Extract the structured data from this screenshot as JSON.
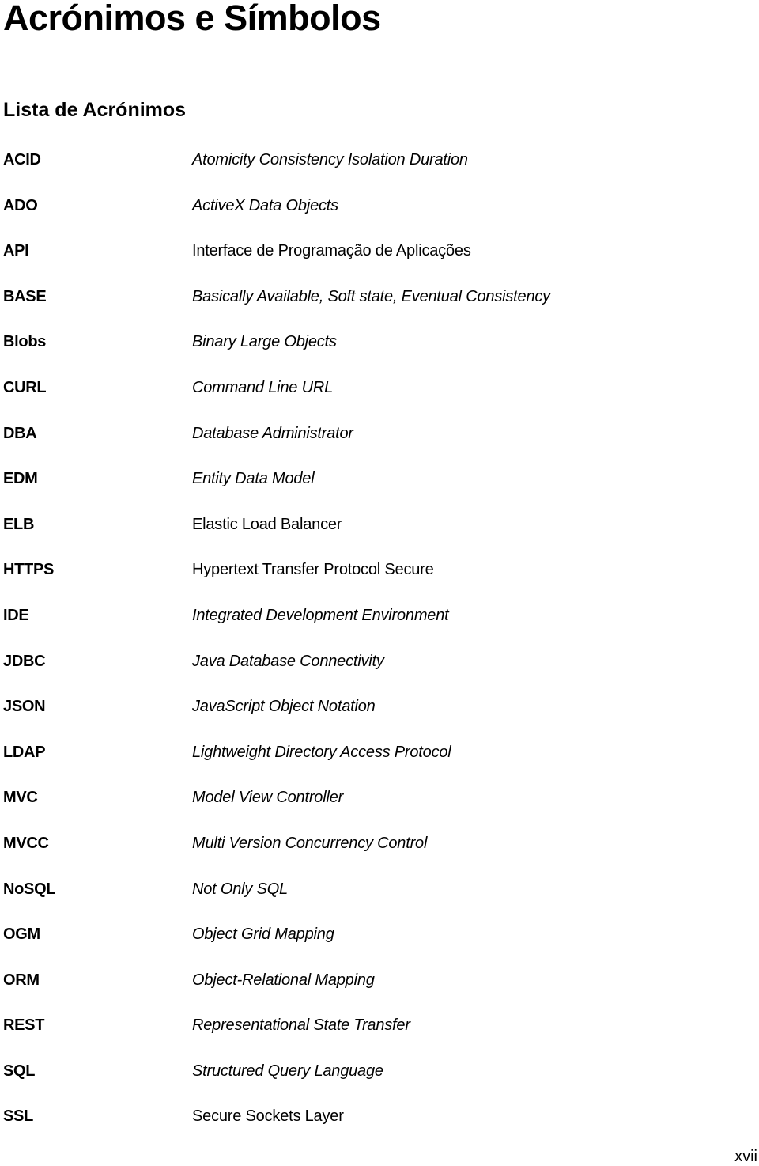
{
  "document": {
    "title": "Acrónimos e Símbolos",
    "section_title": "Lista de Acrónimos",
    "page_number": "xvii"
  },
  "acronyms": [
    {
      "term": "ACID",
      "definition": "Atomicity Consistency Isolation Duration",
      "italic": true
    },
    {
      "term": "ADO",
      "definition": "ActiveX Data Objects",
      "italic": true
    },
    {
      "term": "API",
      "definition": "Interface de Programação de Aplicações",
      "italic": false
    },
    {
      "term": "BASE",
      "definition": "Basically Available, Soft state, Eventual Consistency",
      "italic": true
    },
    {
      "term": "Blobs",
      "definition": "Binary Large Objects",
      "italic": true
    },
    {
      "term": "CURL",
      "definition": "Command Line URL",
      "italic": true
    },
    {
      "term": "DBA",
      "definition": "Database Administrator",
      "italic": true
    },
    {
      "term": "EDM",
      "definition": "Entity Data Model",
      "italic": true
    },
    {
      "term": "ELB",
      "definition": "Elastic Load Balancer",
      "italic": false
    },
    {
      "term": "HTTPS",
      "definition": "Hypertext Transfer Protocol Secure",
      "italic": false
    },
    {
      "term": "IDE",
      "definition": "Integrated Development Environment",
      "italic": true
    },
    {
      "term": "JDBC",
      "definition": "Java Database Connectivity",
      "italic": true
    },
    {
      "term": "JSON",
      "definition": "JavaScript Object Notation",
      "italic": true
    },
    {
      "term": "LDAP",
      "definition": "Lightweight Directory Access Protocol",
      "italic": true
    },
    {
      "term": "MVC",
      "definition": "Model View Controller",
      "italic": true
    },
    {
      "term": "MVCC",
      "definition": "Multi Version Concurrency Control",
      "italic": true
    },
    {
      "term": "NoSQL",
      "definition": "Not Only SQL",
      "italic": true
    },
    {
      "term": "OGM",
      "definition": "Object Grid Mapping",
      "italic": true
    },
    {
      "term": "ORM",
      "definition": "Object-Relational Mapping",
      "italic": true
    },
    {
      "term": "REST",
      "definition": "Representational State Transfer",
      "italic": true
    },
    {
      "term": "SQL",
      "definition": "Structured Query Language",
      "italic": true
    },
    {
      "term": "SSL",
      "definition": "Secure Sockets Layer",
      "italic": false
    }
  ]
}
